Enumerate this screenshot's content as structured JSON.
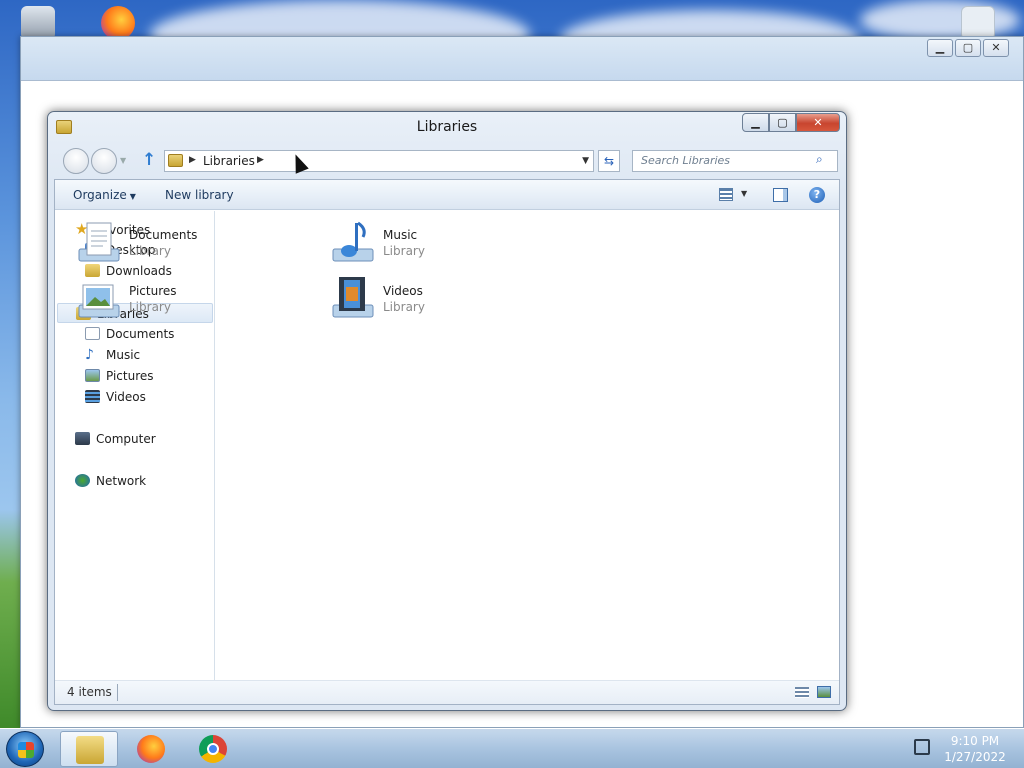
{
  "window": {
    "title": "Libraries",
    "caption_minimize": "▁",
    "caption_maximize": "▢",
    "caption_close": "✕"
  },
  "address_bar": {
    "crumb": "Libraries",
    "refresh_icon": "refresh-icon"
  },
  "search": {
    "placeholder": "Search Libraries"
  },
  "toolbar": {
    "organize_label": "Organize",
    "new_library_label": "New library",
    "help_glyph": "?"
  },
  "nav_pane": {
    "favorites": "Favorites",
    "desktop": "Desktop",
    "downloads": "Downloads",
    "libraries": "Libraries",
    "documents": "Documents",
    "music": "Music",
    "pictures": "Pictures",
    "videos": "Videos",
    "computer": "Computer",
    "network": "Network"
  },
  "libraries": [
    {
      "name": "Documents",
      "type": "Library"
    },
    {
      "name": "Music",
      "type": "Library"
    },
    {
      "name": "Pictures",
      "type": "Library"
    },
    {
      "name": "Videos",
      "type": "Library"
    }
  ],
  "status_bar": {
    "item_count": "4 items"
  },
  "taskbar": {
    "time": "9:10 PM",
    "date": "1/27/2022"
  },
  "colors": {
    "accent": "#2f7dd1",
    "window_frame": "#dde7f3",
    "close_button": "#c8452f"
  }
}
